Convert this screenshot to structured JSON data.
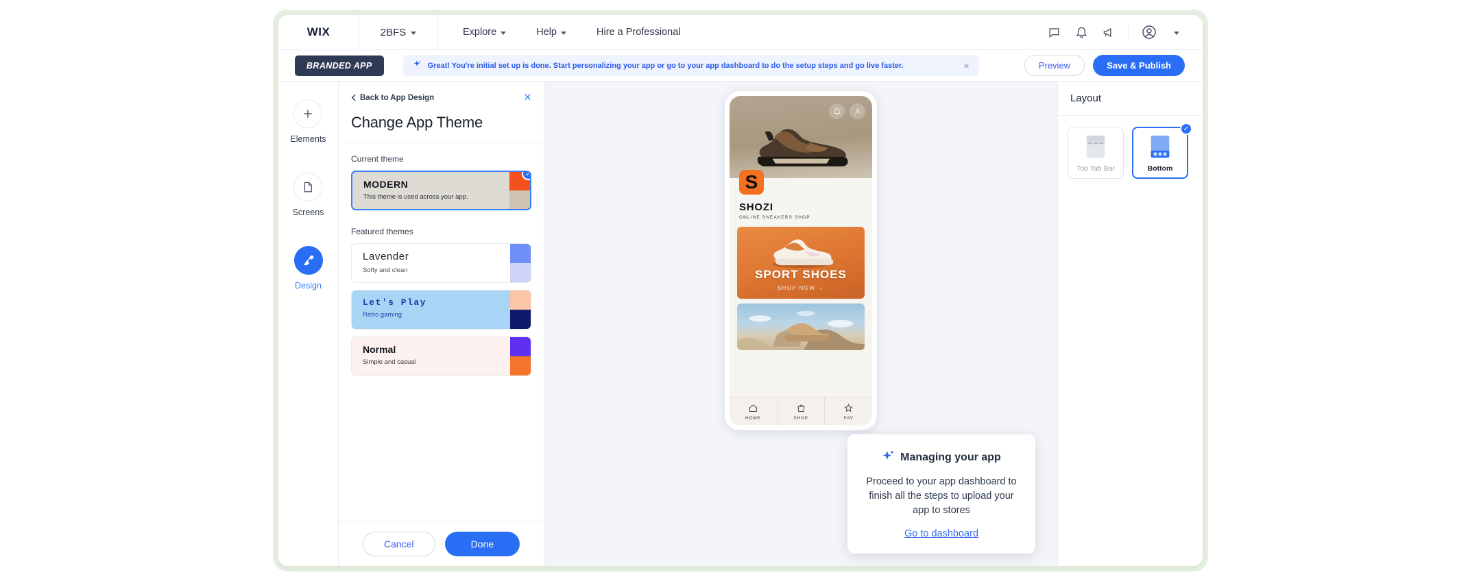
{
  "topbar": {
    "logo": "WIX",
    "site": "2BFS",
    "links": [
      {
        "label": "Explore",
        "caret": true
      },
      {
        "label": "Help",
        "caret": true
      },
      {
        "label": "Hire a Professional",
        "caret": false
      }
    ],
    "icons": [
      "chat-icon",
      "bell-icon",
      "megaphone-icon",
      "account-icon",
      "chevron-down-icon"
    ]
  },
  "secondbar": {
    "chip": "BRANDED APP",
    "notification": "Great! You're initial set up is done. Start personalizing your app or go to your app dashboard to do the setup  steps and  go live faster.",
    "notification_close": "×",
    "preview_label": "Preview",
    "publish_label": "Save & Publish",
    "accent": "#2a6ef5",
    "banner_bg": "#eef3fe"
  },
  "rail": {
    "items": [
      {
        "label": "Elements",
        "icon": "plus-icon",
        "active": false
      },
      {
        "label": "Screens",
        "icon": "page-icon",
        "active": false
      },
      {
        "label": "Design",
        "icon": "brush-icon",
        "active": true
      }
    ]
  },
  "theme_panel": {
    "back_label": "Back to App Design",
    "close_label": "×",
    "title": "Change App Theme",
    "current_label": "Current theme",
    "featured_label": "Featured themes",
    "current_theme": {
      "name": "MODERN",
      "desc": "This theme is used across your app.",
      "bg": "#dedbd5",
      "name_color": "#14161a",
      "desc_color": "#20242c",
      "swatch": [
        "#f4511e",
        "#cfc4b4"
      ],
      "selected": true
    },
    "featured": [
      {
        "name": "Lavender",
        "desc": "Softy and clean",
        "bg": "#ffffff",
        "name_color": "#1c2330",
        "desc_color": "#3c4452",
        "swatch": [
          "#6f8ef7",
          "#cfd3fa"
        ],
        "selected": false
      },
      {
        "name": "Let's Play",
        "desc": "Retro gaming",
        "bg": "#a8d5f5",
        "name_color": "#1b3ea8",
        "desc_color": "#1b3ea8",
        "swatch": [
          "#fbc5a8",
          "#0f1a6b"
        ],
        "selected": false
      },
      {
        "name": "Normal",
        "desc": "Simple and casual",
        "bg": "#fdf1ef",
        "name_color": "#14161a",
        "desc_color": "#2c3038",
        "swatch": [
          "#6030f0",
          "#f5732a"
        ],
        "selected": false
      }
    ],
    "cancel_label": "Cancel",
    "done_label": "Done"
  },
  "phone_preview": {
    "logo_letter": "S",
    "brand_name": "SHOZI",
    "brand_tagline": "ONLINE SNEAKERS SHOP",
    "promo_title": "SPORT SHOES",
    "promo_subtitle": "SHOP NOW →",
    "header_icons": [
      "bell-icon",
      "account-icon"
    ],
    "bottom_nav": [
      {
        "label": "HOME",
        "icon": "home-icon"
      },
      {
        "label": "SHOP",
        "icon": "bag-icon"
      },
      {
        "label": "FAV",
        "icon": "star-icon"
      }
    ]
  },
  "layout_panel": {
    "title": "Layout",
    "options": [
      {
        "label": "Top Tab Bar",
        "selected": false
      },
      {
        "label": "Bottom",
        "selected": true
      }
    ]
  },
  "tip_card": {
    "icon": "sparkle-icon",
    "title": "Managing your app",
    "body": "Proceed to your app dashboard to finish all the steps to upload your app to stores",
    "link": "Go to dashboard"
  }
}
